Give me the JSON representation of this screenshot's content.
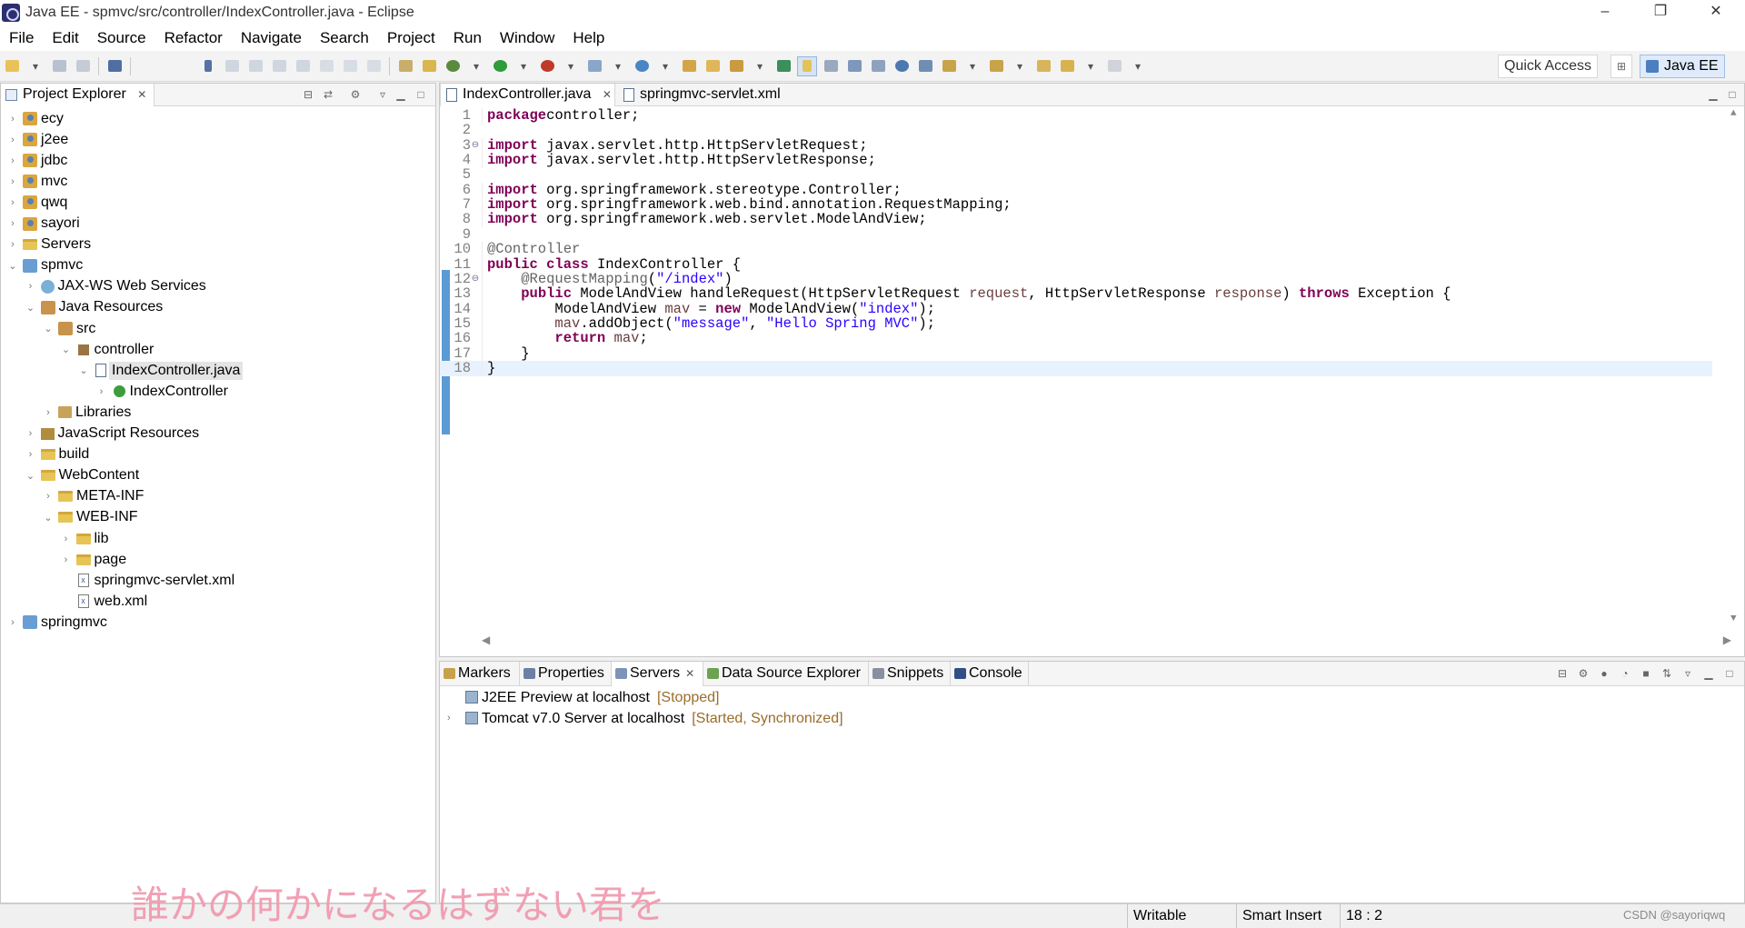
{
  "window": {
    "title": "Java EE - spmvc/src/controller/IndexController.java - Eclipse",
    "minimize": "–",
    "restore": "❐",
    "close": "✕"
  },
  "menu": [
    "File",
    "Edit",
    "Source",
    "Refactor",
    "Navigate",
    "Search",
    "Project",
    "Run",
    "Window",
    "Help"
  ],
  "toolbar": {
    "quick_access": "Quick Access",
    "perspective": "Java EE"
  },
  "explorer": {
    "title": "Project Explorer",
    "close": "✕",
    "tree": [
      {
        "label": "ecy",
        "depth": 0,
        "twisty": ">",
        "icon": "proj"
      },
      {
        "label": "j2ee",
        "depth": 0,
        "twisty": ">",
        "icon": "proj"
      },
      {
        "label": "jdbc",
        "depth": 0,
        "twisty": ">",
        "icon": "proj"
      },
      {
        "label": "mvc",
        "depth": 0,
        "twisty": ">",
        "icon": "proj"
      },
      {
        "label": "qwq",
        "depth": 0,
        "twisty": ">",
        "icon": "proj"
      },
      {
        "label": "sayori",
        "depth": 0,
        "twisty": ">",
        "icon": "proj"
      },
      {
        "label": "Servers",
        "depth": 0,
        "twisty": ">",
        "icon": "folder"
      },
      {
        "label": "spmvc",
        "depth": 0,
        "twisty": "v",
        "icon": "webproj"
      },
      {
        "label": "JAX-WS Web Services",
        "depth": 1,
        "twisty": ">",
        "icon": "svc"
      },
      {
        "label": "Java Resources",
        "depth": 1,
        "twisty": "v",
        "icon": "pkgroot"
      },
      {
        "label": "src",
        "depth": 2,
        "twisty": "v",
        "icon": "pkgroot"
      },
      {
        "label": "controller",
        "depth": 3,
        "twisty": "v",
        "icon": "pkg"
      },
      {
        "label": "IndexController.java",
        "depth": 4,
        "twisty": "v",
        "icon": "jfile",
        "selected": true
      },
      {
        "label": "IndexController",
        "depth": 5,
        "twisty": ">",
        "icon": "cls"
      },
      {
        "label": "Libraries",
        "depth": 2,
        "twisty": ">",
        "icon": "lib"
      },
      {
        "label": "JavaScript Resources",
        "depth": 1,
        "twisty": ">",
        "icon": "jsres"
      },
      {
        "label": "build",
        "depth": 1,
        "twisty": ">",
        "icon": "folder"
      },
      {
        "label": "WebContent",
        "depth": 1,
        "twisty": "v",
        "icon": "folder"
      },
      {
        "label": "META-INF",
        "depth": 2,
        "twisty": ">",
        "icon": "folder"
      },
      {
        "label": "WEB-INF",
        "depth": 2,
        "twisty": "v",
        "icon": "folder"
      },
      {
        "label": "lib",
        "depth": 3,
        "twisty": ">",
        "icon": "folder"
      },
      {
        "label": "page",
        "depth": 3,
        "twisty": ">",
        "icon": "folder"
      },
      {
        "label": "springmvc-servlet.xml",
        "depth": 3,
        "twisty": "",
        "icon": "xfile"
      },
      {
        "label": "web.xml",
        "depth": 3,
        "twisty": "",
        "icon": "xfile"
      },
      {
        "label": "springmvc",
        "depth": 0,
        "twisty": ">",
        "icon": "webproj"
      }
    ]
  },
  "editor": {
    "tabs": [
      {
        "label": "IndexController.java",
        "active": true
      },
      {
        "label": "springmvc-servlet.xml",
        "active": false
      }
    ],
    "lines": [
      {
        "n": "1",
        "fold": "",
        "tokens": [
          [
            "kw",
            "package"
          ],
          [
            "",
            "controller;"
          ]
        ]
      },
      {
        "n": "2",
        "fold": "",
        "tokens": []
      },
      {
        "n": "3",
        "fold": "⊖",
        "tokens": [
          [
            "kw",
            "import"
          ],
          [
            "",
            " javax.servlet.http.HttpServletRequest;"
          ]
        ]
      },
      {
        "n": "4",
        "fold": "",
        "tokens": [
          [
            "kw",
            "import"
          ],
          [
            "",
            " javax.servlet.http.HttpServletResponse;"
          ]
        ]
      },
      {
        "n": "5",
        "fold": "",
        "tokens": []
      },
      {
        "n": "6",
        "fold": "",
        "tokens": [
          [
            "kw",
            "import"
          ],
          [
            "",
            " org.springframework.stereotype.Controller;"
          ]
        ]
      },
      {
        "n": "7",
        "fold": "",
        "tokens": [
          [
            "kw",
            "import"
          ],
          [
            "",
            " org.springframework.web.bind.annotation.RequestMapping;"
          ]
        ]
      },
      {
        "n": "8",
        "fold": "",
        "tokens": [
          [
            "kw",
            "import"
          ],
          [
            "",
            " org.springframework.web.servlet.ModelAndView;"
          ]
        ]
      },
      {
        "n": "9",
        "fold": "",
        "tokens": []
      },
      {
        "n": "10",
        "fold": "",
        "tokens": [
          [
            "an",
            "@Controller"
          ]
        ]
      },
      {
        "n": "11",
        "fold": "",
        "tokens": [
          [
            "kw",
            "public"
          ],
          [
            "",
            " "
          ],
          [
            "kw",
            "class"
          ],
          [
            "",
            " IndexController {"
          ]
        ]
      },
      {
        "n": "12",
        "fold": "⊖",
        "tokens": [
          [
            "",
            "    "
          ],
          [
            "an",
            "@RequestMapping"
          ],
          [
            "",
            "("
          ],
          [
            "st",
            "\"/index\""
          ],
          [
            "",
            ")"
          ]
        ]
      },
      {
        "n": "13",
        "fold": "",
        "tokens": [
          [
            "",
            "    "
          ],
          [
            "kw",
            "public"
          ],
          [
            "",
            " ModelAndView handleRequest(HttpServletRequest "
          ],
          [
            "pa",
            "request"
          ],
          [
            "",
            ", HttpServletResponse "
          ],
          [
            "pa",
            "response"
          ],
          [
            "",
            ") "
          ],
          [
            "kw",
            "throws"
          ],
          [
            "",
            " Exception {"
          ]
        ]
      },
      {
        "n": "14",
        "fold": "",
        "tokens": [
          [
            "",
            "        ModelAndView "
          ],
          [
            "pa",
            "mav"
          ],
          [
            "",
            " = "
          ],
          [
            "kw",
            "new"
          ],
          [
            "",
            " ModelAndView("
          ],
          [
            "st",
            "\"index\""
          ],
          [
            "",
            ");"
          ]
        ]
      },
      {
        "n": "15",
        "fold": "",
        "tokens": [
          [
            "",
            "        "
          ],
          [
            "pa",
            "mav"
          ],
          [
            "",
            ".addObject("
          ],
          [
            "st",
            "\"message\""
          ],
          [
            "",
            ", "
          ],
          [
            "st",
            "\"Hello Spring MVC\""
          ],
          [
            "",
            ");"
          ]
        ]
      },
      {
        "n": "16",
        "fold": "",
        "tokens": [
          [
            "",
            "        "
          ],
          [
            "kw",
            "return"
          ],
          [
            "",
            " "
          ],
          [
            "pa",
            "mav"
          ],
          [
            "",
            ";"
          ]
        ]
      },
      {
        "n": "17",
        "fold": "",
        "tokens": [
          [
            "",
            "    }"
          ]
        ]
      },
      {
        "n": "18",
        "fold": "",
        "tokens": [
          [
            "",
            "}"
          ]
        ],
        "current": true
      }
    ]
  },
  "bottom": {
    "tabs": [
      {
        "label": "Markers",
        "active": false,
        "color": "#c7a24b"
      },
      {
        "label": "Properties",
        "active": false,
        "color": "#6d7fa4"
      },
      {
        "label": "Servers",
        "active": true,
        "color": "#7b94b8"
      },
      {
        "label": "Data Source Explorer",
        "active": false,
        "color": "#6ca251"
      },
      {
        "label": "Snippets",
        "active": false,
        "color": "#8a8fa0"
      },
      {
        "label": "Console",
        "active": false,
        "color": "#2f4f86"
      }
    ],
    "servers": [
      {
        "name": "J2EE Preview at localhost",
        "status": "[Stopped]",
        "twisty": ""
      },
      {
        "name": "Tomcat v7.0 Server at localhost",
        "status": "[Started, Synchronized]",
        "twisty": ">"
      }
    ]
  },
  "status": {
    "writable": "Writable",
    "insert_mode": "Smart Insert",
    "position": "18 : 2"
  },
  "overlay": {
    "lyric": "誰かの何かになるはずない君を",
    "credit": "CSDN @sayoriqwq"
  }
}
